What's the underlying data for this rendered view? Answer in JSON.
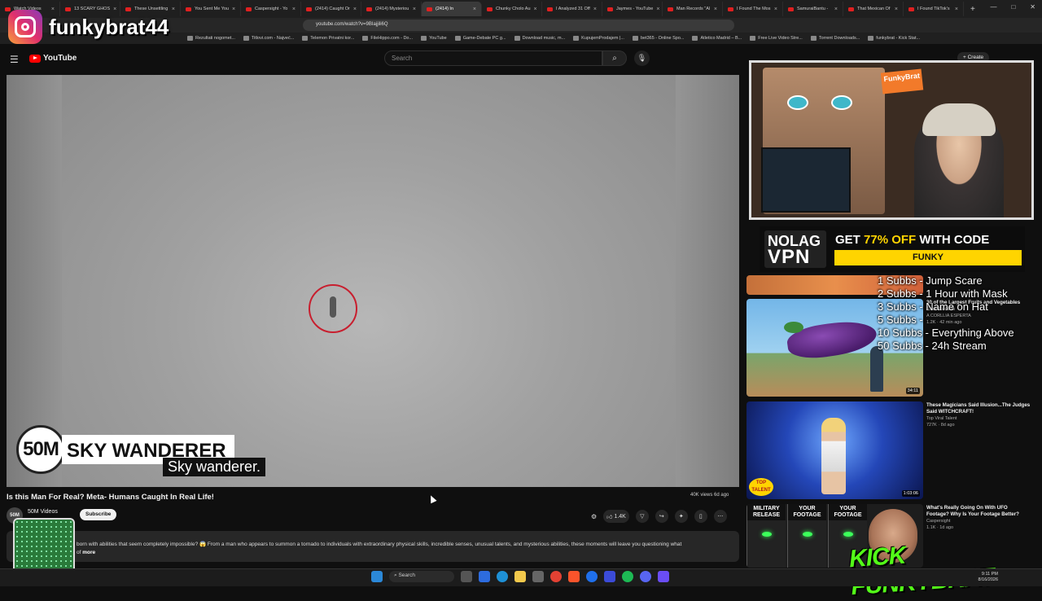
{
  "browser": {
    "tabs": [
      {
        "label": "Watch Videos"
      },
      {
        "label": "13 SCARY GHOS"
      },
      {
        "label": "These Unsettling"
      },
      {
        "label": "You Sent Me You"
      },
      {
        "label": "Caspersight - Yo"
      },
      {
        "label": "(2414) Caught Or"
      },
      {
        "label": "(2414) Mysteriou"
      },
      {
        "label": "(2414) In",
        "active": true
      },
      {
        "label": "Chunky Cholo Au"
      },
      {
        "label": "I Analyzed 31 Off"
      },
      {
        "label": "Jaymes - YouTube"
      },
      {
        "label": "Man Records \"Al"
      },
      {
        "label": "I Found The Mos"
      },
      {
        "label": "SamuraiBantu -"
      },
      {
        "label": "That Mexican Of"
      },
      {
        "label": "I Found TikTok's"
      }
    ],
    "new_tab": "+",
    "url": "youtube.com/watch?v=9BIajjili6Q",
    "bookmarks": [
      "Rezultati nogomet...",
      "Titlovi.com - Najveć...",
      "Telemon Privatni kor...",
      "FileHippo.com - Do...",
      "YouTube",
      "Game-Debate PC g...",
      "Download music, m...",
      "KupujemProdajem |...",
      "bet365 - Online Spo...",
      "Atletico Madrid – B...",
      "Free Live Video Stre...",
      "Torrent Downloads...",
      "funkybrat - Kick Stat..."
    ]
  },
  "overlay": {
    "instagram_handle": "funkybrat44",
    "lower_third_badge": "50M",
    "lower_third_title": "SKY WANDERER",
    "subtitle": "Sky wanderer.",
    "goals": [
      "1 Subbs - Jump Scare",
      "2 Subbs - 1 Hour with Mask",
      "3 Subbs - Name on Hat",
      "5 Subbs -",
      "10 Subbs - Everything Above",
      "50 Subbs - 24h Stream"
    ],
    "vpn_logo_top": "NOLAG",
    "vpn_logo_bottom": "VPN",
    "vpn_offer_prefix": "GET ",
    "vpn_offer_pct": "77% OFF",
    "vpn_offer_suffix": " WITH CODE",
    "vpn_code": "FUNKY",
    "webcam_sign": "FunkyBrat",
    "kick_text": "KICK FUNKYBRAT"
  },
  "youtube": {
    "logo": "YouTube",
    "search_placeholder": "Search",
    "create_label": "+ Create",
    "video_title": "Is this Man For Real? Meta- Humans Caught In Real Life!",
    "views": "40K views  6d ago",
    "channel_name": "50M Videos",
    "channel_avatar": "50M",
    "subscribe_label": "Subscribe",
    "likes": "1.4K",
    "description": "born with abilities that seem completely impossible? 😱 From a man who appears to summon a tornado to individuals with extraordinary physical skills, incredible senses, unusual talents, and mysterious abilities, these moments will leave you questioning what",
    "description_tail": "of",
    "more_label": "more"
  },
  "recommendations": [
    {
      "title": "30 of the Largest Fruits and Vegetables Ever Grown",
      "channel": "A CORLLIA ESPERTA",
      "meta": "1.2K · 42 min ago",
      "duration": "34:11"
    },
    {
      "title": "These Magicians Said Illusion...The Judges Said WITCHCRAFT!",
      "channel": "Top Viral Talent",
      "meta": "727K · 8d ago",
      "duration": "1:03:06",
      "badge": "TOP TALENT"
    },
    {
      "title": "What's Really Going On With UFO Footage? Why Is Your Footage Better?",
      "channel": "Caspersight",
      "meta": "1.1K · 1d ago",
      "labels": [
        "MILITARY RELEASE",
        "YOUR FOOTAGE",
        "YOUR FOOTAGE"
      ]
    }
  ],
  "taskbar": {
    "search_label": "Search",
    "time": "9:11 PM",
    "date": "8/16/2026"
  },
  "colors": {
    "youtube_red": "#ff0000",
    "circle_red": "#c81e2e",
    "vpn_yellow": "#ffd400",
    "kick_green": "#53fc18"
  }
}
